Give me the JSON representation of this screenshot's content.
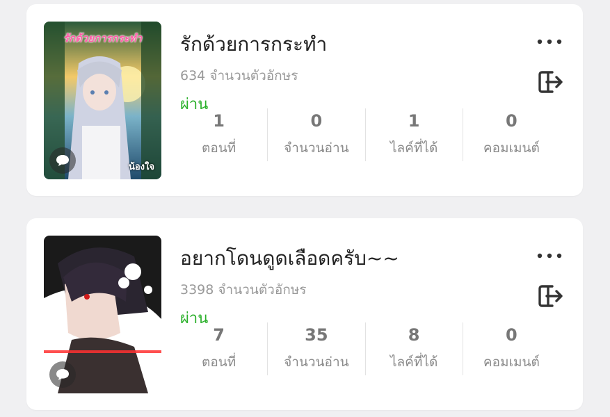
{
  "stories": [
    {
      "title": "รักด้วยการกระทำ",
      "char_count": "634 จำนวนตัวอักษร",
      "status": "ผ่าน",
      "cover_title": "รักด้วยการกระทำ",
      "cover_signature": "น้องใจ",
      "stats": [
        {
          "value": "1",
          "label": "ตอนที่"
        },
        {
          "value": "0",
          "label": "จำนวนอ่าน"
        },
        {
          "value": "1",
          "label": "ไลค์ที่ได้"
        },
        {
          "value": "0",
          "label": "คอมเมนต์"
        }
      ]
    },
    {
      "title": "อยากโดนดูดเลือดครับ~~",
      "char_count": "3398 จำนวนตัวอักษร",
      "status": "ผ่าน",
      "stats": [
        {
          "value": "7",
          "label": "ตอนที่"
        },
        {
          "value": "35",
          "label": "จำนวนอ่าน"
        },
        {
          "value": "8",
          "label": "ไลค์ที่ได้"
        },
        {
          "value": "0",
          "label": "คอมเมนต์"
        }
      ]
    }
  ],
  "colors": {
    "status_green": "#2bb02b",
    "background": "#f0f0f2",
    "card": "#ffffff"
  },
  "icons": [
    "more-horizontal-icon",
    "exit-icon",
    "comment-icon"
  ]
}
